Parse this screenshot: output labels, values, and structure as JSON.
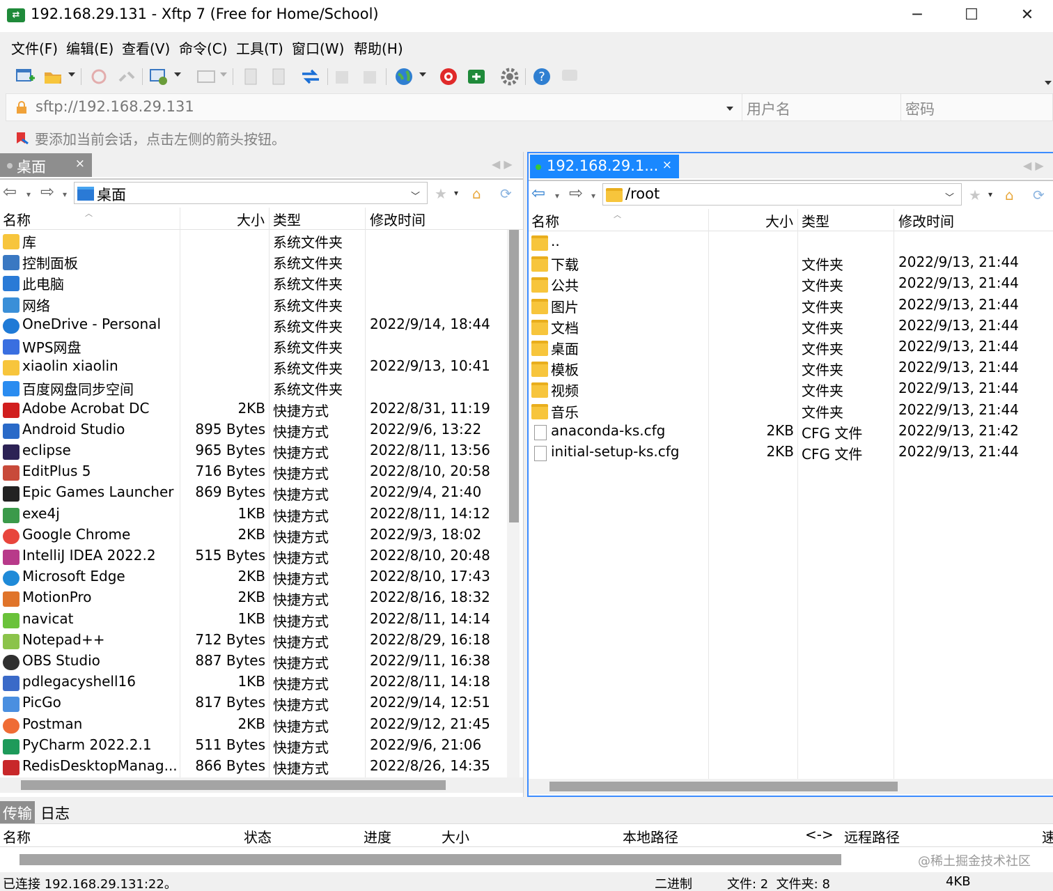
{
  "window": {
    "title": "192.168.29.131 - Xftp 7 (Free for Home/School)",
    "minimize": "─",
    "maximize": "☐",
    "close": "✕"
  },
  "menu": [
    "文件(F)",
    "编辑(E)",
    "查看(V)",
    "命令(C)",
    "工具(T)",
    "窗口(W)",
    "帮助(H)"
  ],
  "address": {
    "url": "sftp://192.168.29.131",
    "username_placeholder": "用户名",
    "password_placeholder": "密码"
  },
  "hint": "要添加当前会话，点击左侧的箭头按钮。",
  "left": {
    "tab_label": "桌面",
    "tab_close": "×",
    "path": "桌面",
    "columns": {
      "name": "名称",
      "size": "大小",
      "type": "类型",
      "modified": "修改时间"
    },
    "rows": [
      {
        "name": "库",
        "size": "",
        "type": "系统文件夹",
        "modified": "",
        "icon": "library-icon"
      },
      {
        "name": "控制面板",
        "size": "",
        "type": "系统文件夹",
        "modified": "",
        "icon": "control-panel-icon"
      },
      {
        "name": "此电脑",
        "size": "",
        "type": "系统文件夹",
        "modified": "",
        "icon": "computer-icon"
      },
      {
        "name": "网络",
        "size": "",
        "type": "系统文件夹",
        "modified": "",
        "icon": "network-icon"
      },
      {
        "name": "OneDrive - Personal",
        "size": "",
        "type": "系统文件夹",
        "modified": "2022/9/14, 18:44",
        "icon": "onedrive-icon"
      },
      {
        "name": "WPS网盘",
        "size": "",
        "type": "系统文件夹",
        "modified": "",
        "icon": "wps-cloud-icon"
      },
      {
        "name": "xiaolin xiaolin",
        "size": "",
        "type": "系统文件夹",
        "modified": "2022/9/13, 10:41",
        "icon": "user-folder-icon"
      },
      {
        "name": "百度网盘同步空间",
        "size": "",
        "type": "系统文件夹",
        "modified": "",
        "icon": "baidu-cloud-icon"
      },
      {
        "name": "Adobe Acrobat DC",
        "size": "2KB",
        "type": "快捷方式",
        "modified": "2022/8/31, 11:19",
        "icon": "acrobat-icon"
      },
      {
        "name": "Android Studio",
        "size": "895 Bytes",
        "type": "快捷方式",
        "modified": "2022/9/6, 13:22",
        "icon": "android-studio-icon"
      },
      {
        "name": "eclipse",
        "size": "965 Bytes",
        "type": "快捷方式",
        "modified": "2022/8/11, 13:56",
        "icon": "eclipse-icon"
      },
      {
        "name": "EditPlus 5",
        "size": "716 Bytes",
        "type": "快捷方式",
        "modified": "2022/8/10, 20:58",
        "icon": "editplus-icon"
      },
      {
        "name": "Epic Games Launcher",
        "size": "869 Bytes",
        "type": "快捷方式",
        "modified": "2022/9/4, 21:40",
        "icon": "epic-games-icon"
      },
      {
        "name": "exe4j",
        "size": "1KB",
        "type": "快捷方式",
        "modified": "2022/8/11, 14:12",
        "icon": "exe4j-icon"
      },
      {
        "name": "Google Chrome",
        "size": "2KB",
        "type": "快捷方式",
        "modified": "2022/9/3, 18:02",
        "icon": "chrome-icon"
      },
      {
        "name": "IntelliJ IDEA 2022.2",
        "size": "515 Bytes",
        "type": "快捷方式",
        "modified": "2022/8/10, 20:48",
        "icon": "intellij-icon"
      },
      {
        "name": "Microsoft Edge",
        "size": "2KB",
        "type": "快捷方式",
        "modified": "2022/8/10, 17:43",
        "icon": "edge-icon"
      },
      {
        "name": "MotionPro",
        "size": "2KB",
        "type": "快捷方式",
        "modified": "2022/8/16, 18:32",
        "icon": "motionpro-icon"
      },
      {
        "name": "navicat",
        "size": "1KB",
        "type": "快捷方式",
        "modified": "2022/8/11, 14:14",
        "icon": "navicat-icon"
      },
      {
        "name": "Notepad++",
        "size": "712 Bytes",
        "type": "快捷方式",
        "modified": "2022/8/29, 16:18",
        "icon": "notepadpp-icon"
      },
      {
        "name": "OBS Studio",
        "size": "887 Bytes",
        "type": "快捷方式",
        "modified": "2022/9/11, 16:38",
        "icon": "obs-icon"
      },
      {
        "name": "pdlegacyshell16",
        "size": "1KB",
        "type": "快捷方式",
        "modified": "2022/8/11, 14:18",
        "icon": "pdlegacyshell-icon"
      },
      {
        "name": "PicGo",
        "size": "817 Bytes",
        "type": "快捷方式",
        "modified": "2022/9/14, 12:51",
        "icon": "picgo-icon"
      },
      {
        "name": "Postman",
        "size": "2KB",
        "type": "快捷方式",
        "modified": "2022/9/12, 21:45",
        "icon": "postman-icon"
      },
      {
        "name": "PyCharm 2022.2.1",
        "size": "511 Bytes",
        "type": "快捷方式",
        "modified": "2022/9/6, 21:06",
        "icon": "pycharm-icon"
      },
      {
        "name": "RedisDesktopManag...",
        "size": "866 Bytes",
        "type": "快捷方式",
        "modified": "2022/8/26, 14:35",
        "icon": "redis-icon"
      }
    ]
  },
  "right": {
    "tab_label": "192.168.29.1...",
    "tab_close": "×",
    "path": "/root",
    "columns": {
      "name": "名称",
      "size": "大小",
      "type": "类型",
      "modified": "修改时间"
    },
    "rows": [
      {
        "name": "..",
        "size": "",
        "type": "",
        "modified": "",
        "kind": "folder"
      },
      {
        "name": "下载",
        "size": "",
        "type": "文件夹",
        "modified": "2022/9/13, 21:44",
        "kind": "folder"
      },
      {
        "name": "公共",
        "size": "",
        "type": "文件夹",
        "modified": "2022/9/13, 21:44",
        "kind": "folder"
      },
      {
        "name": "图片",
        "size": "",
        "type": "文件夹",
        "modified": "2022/9/13, 21:44",
        "kind": "folder"
      },
      {
        "name": "文档",
        "size": "",
        "type": "文件夹",
        "modified": "2022/9/13, 21:44",
        "kind": "folder"
      },
      {
        "name": "桌面",
        "size": "",
        "type": "文件夹",
        "modified": "2022/9/13, 21:44",
        "kind": "folder"
      },
      {
        "name": "模板",
        "size": "",
        "type": "文件夹",
        "modified": "2022/9/13, 21:44",
        "kind": "folder"
      },
      {
        "name": "视频",
        "size": "",
        "type": "文件夹",
        "modified": "2022/9/13, 21:44",
        "kind": "folder"
      },
      {
        "name": "音乐",
        "size": "",
        "type": "文件夹",
        "modified": "2022/9/13, 21:44",
        "kind": "folder"
      },
      {
        "name": "anaconda-ks.cfg",
        "size": "2KB",
        "type": "CFG 文件",
        "modified": "2022/9/13, 21:42",
        "kind": "file"
      },
      {
        "name": "initial-setup-ks.cfg",
        "size": "2KB",
        "type": "CFG 文件",
        "modified": "2022/9/13, 21:44",
        "kind": "file"
      }
    ]
  },
  "transfer": {
    "tabs": [
      "传输",
      "日志"
    ],
    "columns": [
      "名称",
      "状态",
      "进度",
      "大小",
      "本地路径",
      "<->",
      "远程路径",
      "速"
    ],
    "watermark": "@稀土掘金技术社区"
  },
  "status": {
    "connection": "已连接 192.168.29.131:22。",
    "mode": "二进制",
    "counts": "文件: 2  文件夹: 8",
    "size": "4KB"
  },
  "colors": {
    "accent": "#1a88ff",
    "inactive_tab": "#8e8e8e",
    "folder": "#f7c53c"
  }
}
